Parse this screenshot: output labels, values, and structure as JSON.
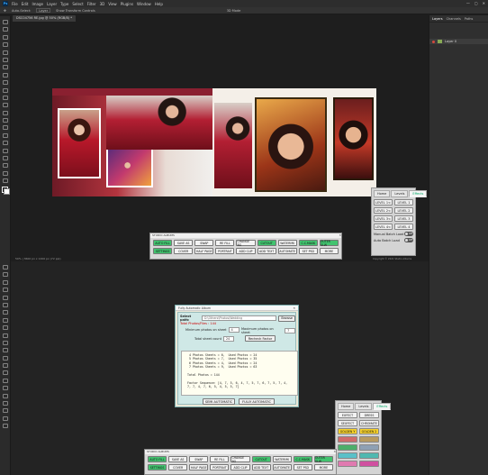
{
  "app": {
    "menu": [
      "File",
      "Edit",
      "Image",
      "Layer",
      "Type",
      "Select",
      "Filter",
      "3D",
      "View",
      "Plugins",
      "Window",
      "Help"
    ],
    "logo": "Ps",
    "window_controls": [
      "—",
      "▢",
      "✕"
    ]
  },
  "options_bar": {
    "auto_select": "Auto-Select:",
    "layer": "Layer",
    "show_transform": "Show Transform Controls",
    "mode_3d": "3D Mode"
  },
  "document": {
    "tab_title": "DSC04756 RE.jpg @ 50% (RGB/8) *",
    "status": "50% | 3600 px x 1200 px (72 ppi)"
  },
  "right_panel": {
    "tabs": [
      "Layers",
      "Channels",
      "Paths"
    ],
    "layer_name": "Layer 0"
  },
  "level_panel": {
    "tabs": [
      "Home",
      "Levels",
      "Effects"
    ],
    "active_tab": "Effects",
    "levels": [
      "LEVEL 1<",
      "LEVEL 1",
      "LEVEL 2<",
      "LEVEL 2",
      "LEVEL 3<",
      "LEVEL 3",
      "LEVEL 4<",
      "LEVEL 4"
    ],
    "toggles": [
      {
        "label": "Manual Batch Load",
        "state": "Off"
      },
      {
        "label": "Auto Batch Load",
        "state": "Off"
      }
    ]
  },
  "studio_panel": {
    "title": "STUDIO ALBUMS",
    "row1": [
      "AUTO FILL",
      "SAVE AS",
      "SWAP",
      "RE FILL",
      "CHANGE BG",
      "CUTOUT",
      "WATERMK",
      "C.C.MASK"
    ],
    "row1_extra": "OUTER GLW",
    "row2": [
      "SETTINGS",
      "COVER",
      "HALF PAGE",
      "PORTRAIT",
      "ADD CLIP",
      "ADD TEXT",
      "AUTOMATE",
      "SET PSD"
    ],
    "row2_extra": "MORE",
    "copyright": "Copyright © 2021 Studio Albums"
  },
  "dialog": {
    "title": "Fully Automatic Album",
    "select_path_label": "Select path:",
    "path_value": "D:\\Others\\Photos\\Wedding",
    "browse": "Browse",
    "total_photos": "Total Photos/Files : 144",
    "min_photos_label": "Minimum photos on sheet",
    "min_photos": "4",
    "max_photos_label": "Maximum photos on sheet",
    "max_photos": "7",
    "total_sheets_label": "Total sheet count",
    "total_sheets": "24",
    "recheck": "Recheck Factor",
    "results": "  4 Photos Sheets = 6,  Used Photos = 24\n  5 Photos Sheets = 7,  Used Photos = 35\n  6 Photos Sheets = 4,  Used Photos = 24\n  7 Photos Sheets = 9,  Used Photos = 63\n\n Total Photos = 144\n\n Factor Sequence: [4, 7, 5, 6, 4, 7, 5, 7, 6, 7, 5, 7, 4,\n 7, 7, 4, 7, 6, 5, 4, 5, 5, 7]",
    "semi_auto": "SEMI AUTOMATIC",
    "fully_auto": "FULLY AUTOMATIC"
  },
  "effects_panel": {
    "tabs": [
      "Home",
      "Levels",
      "Effects"
    ],
    "buttons": [
      {
        "label": "EXFECT",
        "color": "#f2f2f2"
      },
      {
        "label": "DRESS",
        "color": "#f2f2f2"
      },
      {
        "label": "SEXFECT",
        "color": "#f2f2f2"
      },
      {
        "label": "CHROMATE",
        "color": "#f2f2f2"
      },
      {
        "label": "GOLDEN Y",
        "color": "#f5d02a"
      },
      {
        "label": "GOLDEN 2",
        "color": "#f5d02a"
      },
      {
        "label": "",
        "color": "#d06a6a"
      },
      {
        "label": "",
        "color": "#b89a60"
      },
      {
        "label": "",
        "color": "#4cae6a"
      },
      {
        "label": "",
        "color": "#8ea0b4"
      },
      {
        "label": "",
        "color": "#5ac0c8"
      },
      {
        "label": "",
        "color": "#4fb8b0"
      },
      {
        "label": "",
        "color": "#e07ab0"
      },
      {
        "label": "",
        "color": "#d050a0"
      }
    ]
  },
  "colors": {
    "green_btn": "#42c36f",
    "accent_blue": "#31a8ff"
  }
}
